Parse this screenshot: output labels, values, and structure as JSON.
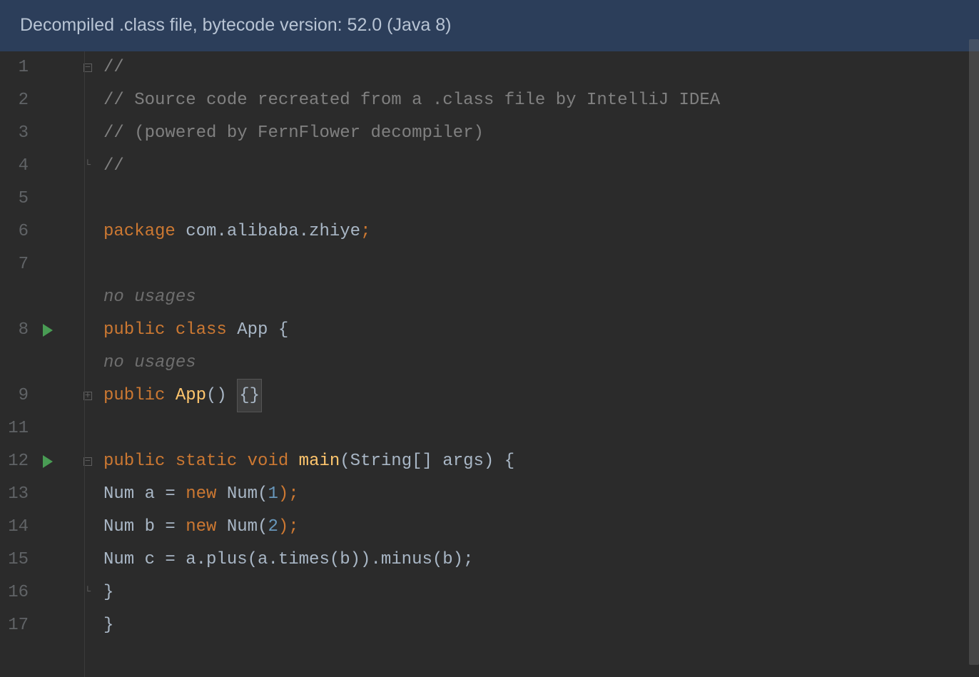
{
  "banner": {
    "text": "Decompiled .class file, bytecode version: 52.0 (Java 8)"
  },
  "gutter": {
    "lines": [
      "1",
      "2",
      "3",
      "4",
      "5",
      "6",
      "7",
      "8",
      "9",
      "11",
      "12",
      "13",
      "14",
      "15",
      "16",
      "17"
    ]
  },
  "inlays": {
    "no_usages_class": "no usages",
    "no_usages_ctor": "no usages"
  },
  "code": {
    "l1": "//",
    "l2": "// Source code recreated from a .class file by IntelliJ IDEA",
    "l3": "// (powered by FernFlower decompiler)",
    "l4": "//",
    "l6_kw": "package",
    "l6_pkg": " com.alibaba.zhiye",
    "l6_semi": ";",
    "l8_public": "public",
    "l8_class": " class",
    "l8_name": " App ",
    "l8_brace": "{",
    "l9_public": "public",
    "l9_name": " App",
    "l9_parens": "() ",
    "l9_braces": "{}",
    "l12_public": "public",
    "l12_static": " static",
    "l12_void": " void",
    "l12_main": " main",
    "l12_params": "(String[] args) {",
    "l13_a": "Num a = ",
    "l13_new": "new",
    "l13_b": " Num(",
    "l13_n": "1",
    "l13_c": ");",
    "l14_a": "Num b = ",
    "l14_new": "new",
    "l14_b": " Num(",
    "l14_n": "2",
    "l14_c": ");",
    "l15": "Num c = a.plus(a.times(b)).minus(b);",
    "l16": "}",
    "l17": "}"
  }
}
